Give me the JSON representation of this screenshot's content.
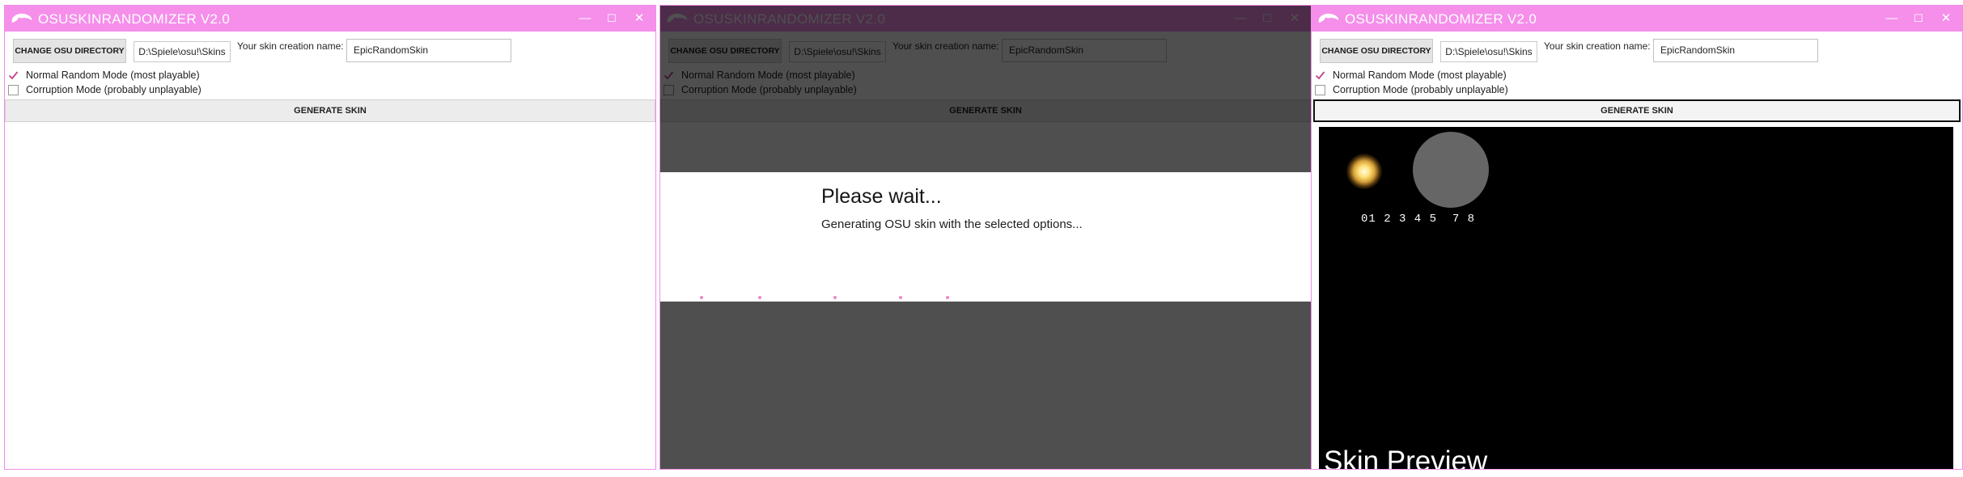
{
  "app": {
    "title": "OSUSKINRANDOMIZER V2.0",
    "accent_color": "#f58fea",
    "window_controls": {
      "minimize": "—",
      "maximize": "☐",
      "close": "✕"
    }
  },
  "toolbar": {
    "change_dir_label": "CHANGE OSU DIRECTORY",
    "skins_path": "D:\\Spiele\\osu!\\Skins",
    "skin_name_label": "Your skin creation name:",
    "skin_name_value": "EpicRandomSkin"
  },
  "options": {
    "normal_mode_label": "Normal Random Mode (most playable)",
    "normal_mode_checked": true,
    "corruption_mode_label": "Corruption Mode (probably unplayable)",
    "corruption_mode_checked": false
  },
  "generate_label": "GENERATE SKIN",
  "wait_dialog": {
    "title": "Please wait...",
    "message": "Generating OSU skin with the selected options..."
  },
  "preview": {
    "score_digits": "01 2 3 4 5  7 8",
    "label": "Skin Preview"
  }
}
